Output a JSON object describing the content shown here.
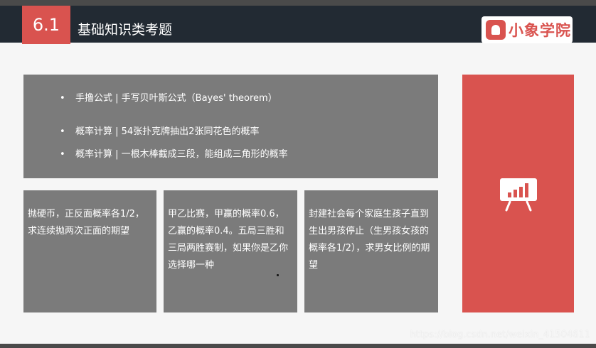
{
  "header": {
    "section_number": "6.1",
    "title": "基础知识类考题",
    "logo_text": "小象学院"
  },
  "bullets": [
    "手撸公式 | 手写贝叶斯公式（Bayes' theorem）",
    "概率计算 | 54张扑克牌抽出2张同花色的概率",
    "概率计算 | 一根木棒截成三段，能组成三角形的概率"
  ],
  "bullet_marker": "•",
  "cards": [
    "抛硬币，正反面概率各1/2，求连续抛两次正面的期望",
    "甲乙比赛，甲赢的概率0.6，乙赢的概率0.4。五局三胜和三局两胜赛制，如果你是乙你选择哪一种",
    "封建社会每个家庭生孩子直到生出男孩停止（生男孩女孩的概率各1/2），求男女比例的期望"
  ],
  "watermark": "https://blog.csdn.net/weixin_41504611",
  "colors": {
    "accent": "#d9534f",
    "header_bg": "#222a33",
    "panel_bg": "#7b7b7b"
  },
  "icons": {
    "side_panel": "presentation-chart-icon"
  }
}
